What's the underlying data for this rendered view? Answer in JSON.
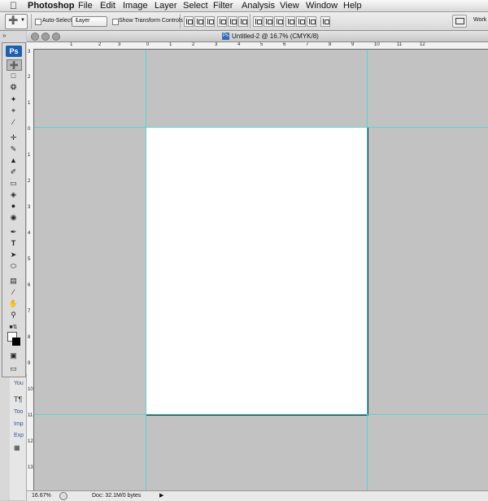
{
  "menubar": {
    "apple": "",
    "app_name": "Photoshop",
    "items": [
      "File",
      "Edit",
      "Image",
      "Layer",
      "Select",
      "Filter",
      "Analysis",
      "View",
      "Window",
      "Help"
    ]
  },
  "options_bar": {
    "auto_select_label": "Auto-Select:",
    "auto_select_checked": false,
    "target_value": "Layer",
    "show_transform_label": "Show Transform Controls",
    "show_transform_checked": false,
    "workspace_label": "Work"
  },
  "toolbox": {
    "logo": "Ps",
    "tools": [
      "move",
      "marquee",
      "lasso",
      "quick-selection",
      "crop",
      "eyedropper",
      "healing-brush",
      "brush",
      "clone-stamp",
      "history-brush",
      "eraser",
      "paint-bucket",
      "blur",
      "dodge",
      "pen",
      "type",
      "path-selection",
      "ellipse",
      "notes",
      "eyedropper-2",
      "hand",
      "zoom"
    ],
    "type_tool_glyph": "T",
    "foreground_color": "#000000",
    "background_color": "#ffffff"
  },
  "document": {
    "title": "Untitled-2 @ 16.7% (CMYK/8)",
    "doc_icon": "Ps",
    "ruler_h_labels": [
      "1",
      "2",
      "3",
      "0",
      "1",
      "2",
      "3",
      "4",
      "5",
      "6",
      "7",
      "8",
      "9",
      "10",
      "11",
      "12"
    ],
    "ruler_v_labels": [
      "3",
      "2",
      "1",
      "0",
      "1",
      "2",
      "3",
      "4",
      "5",
      "6",
      "7",
      "8",
      "9",
      "10",
      "11",
      "12",
      "13"
    ]
  },
  "status_bar": {
    "zoom": "16.67%",
    "doc_info": "Doc: 32.1M/0 bytes"
  },
  "side_panel": {
    "labels": [
      "You",
      "Too",
      "Imp",
      "Exp"
    ]
  },
  "colors": {
    "guide": "#51d7d7",
    "pasteboard": "#c2c2c2",
    "page": "#ffffff"
  }
}
